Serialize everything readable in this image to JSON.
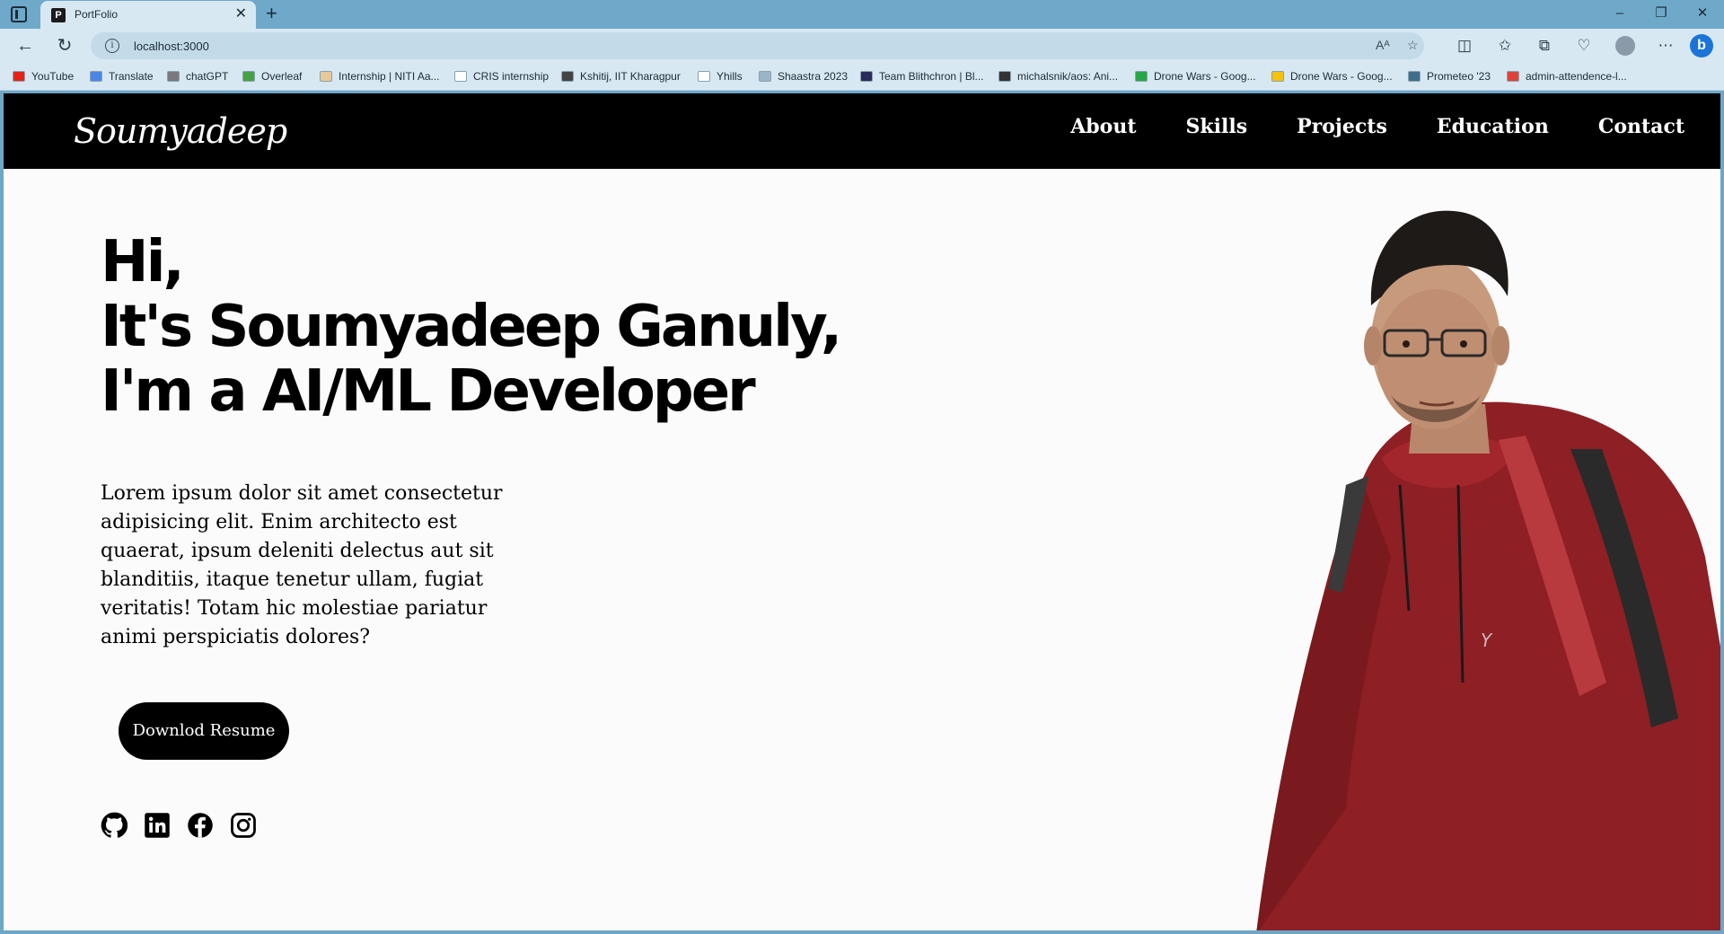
{
  "browser": {
    "tab_title": "PortFolio",
    "tab_favicon_letter": "P",
    "url": "localhost:3000",
    "bookmarks": [
      "YouTube",
      "Translate",
      "chatGPT",
      "Overleaf",
      "Internship | NITI Aa...",
      "CRIS internship",
      "Kshitij, IIT Kharagpur",
      "Yhills",
      "Shaastra 2023",
      "Team Blithchron | Bl...",
      "michalsnik/aos: Ani...",
      "Drone Wars - Goog...",
      "Drone Wars - Goog...",
      "Prometeo '23",
      "admin-attendence-l..."
    ],
    "bookmark_colors": [
      "#e62117",
      "#4a86e8",
      "#7a7a7a",
      "#47a141",
      "#e8c99a",
      "#ffffff",
      "#444444",
      "#ffffff",
      "#9bb5c8",
      "#2b2a5c",
      "#333333",
      "#27a644",
      "#f4c20d",
      "#3e6e8a",
      "#e0413a"
    ]
  },
  "site": {
    "logo": "Soumyadeep",
    "nav": [
      "About",
      "Skills",
      "Projects",
      "Education",
      "Contact"
    ],
    "hero": {
      "line1": "Hi,",
      "line2": "It's Soumyadeep Ganuly,",
      "line3": "I'm a AI/ML Developer",
      "description": "Lorem ipsum dolor sit amet consectetur adipisicing elit. Enim architecto est quaerat, ipsum deleniti delectus aut sit blanditiis, itaque tenetur ullam, fugiat veritatis! Totam hic molestiae pariatur animi perspiciatis dolores?",
      "button": "Downlod Resume"
    },
    "socials": [
      "github-icon",
      "linkedin-icon",
      "facebook-icon",
      "instagram-icon"
    ]
  }
}
